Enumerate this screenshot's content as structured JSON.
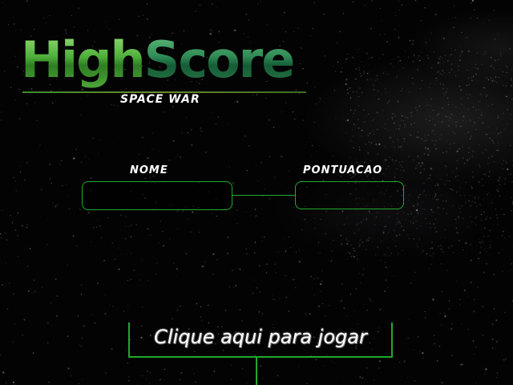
{
  "title": {
    "part1": "High",
    "part2": "Score",
    "subtitle": "SPACE WAR"
  },
  "form": {
    "name_label": "NOME",
    "score_label": "PONTUACAO",
    "name_value": "",
    "score_value": ""
  },
  "play": {
    "label": "Clique aqui para jogar"
  },
  "colors": {
    "accent": "#1faa2a",
    "title_green": "#4faf3b",
    "title_dark_green": "#2f8a55",
    "text": "#ffffff",
    "background": "#030304"
  }
}
